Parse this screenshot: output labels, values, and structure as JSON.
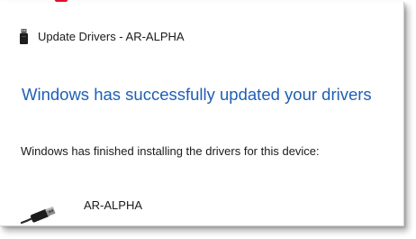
{
  "colors": {
    "headline": "#1e5fb5",
    "annotation_red": "#e4112a"
  },
  "window": {
    "title": "Update Drivers - AR-ALPHA",
    "title_icon": "usb-drive-icon"
  },
  "content": {
    "headline": "Windows has successfully updated your drivers",
    "message": "Windows has finished installing the drivers for this device:",
    "device": {
      "icon": "usb-device-icon",
      "name": "AR-ALPHA"
    }
  }
}
